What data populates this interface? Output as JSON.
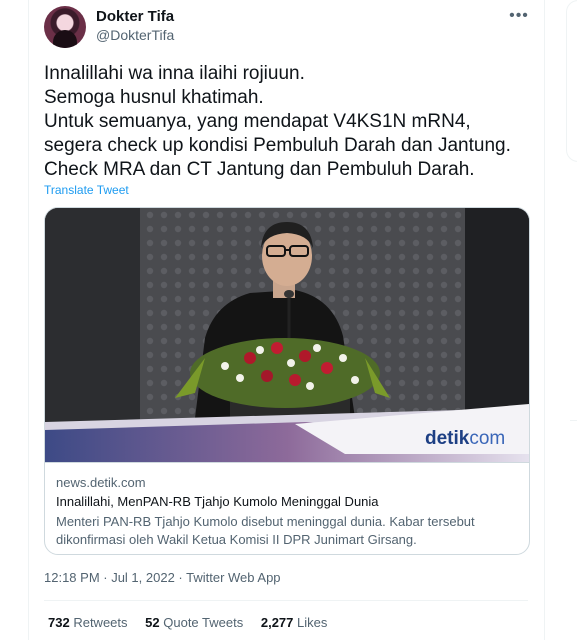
{
  "tweet": {
    "author": {
      "display_name": "Dokter Tifa",
      "handle": "@DokterTifa"
    },
    "text_lines": [
      "Innalillahi wa inna ilaihi rojiuun.",
      "Semoga husnul khatimah.",
      "Untuk semuanya, yang mendapat V4KS1N mRN4,",
      "segera check up kondisi Pembuluh Darah dan Jantung.",
      "Check MRA dan CT  Jantung dan Pembuluh Darah."
    ],
    "translate_label": "Translate Tweet",
    "more_icon": "more-horizontal-icon",
    "timestamp": "12:18 PM · Jul 1, 2022 · Twitter Web App"
  },
  "card": {
    "image_watermark": "detikcom",
    "domain": "news.detik.com",
    "title": "Innalillahi, MenPAN-RB Tjahjo Kumolo Meninggal Dunia",
    "description_lines": [
      "Menteri PAN-RB Tjahjo Kumolo disebut meninggal dunia. Kabar tersebut",
      "dikonfirmasi oleh Wakil Ketua Komisi II DPR Junimart Girsang."
    ]
  },
  "stats": {
    "retweets": {
      "count": "732",
      "label": "Retweets"
    },
    "quotes": {
      "count": "52",
      "label": "Quote Tweets"
    },
    "likes": {
      "count": "2,277",
      "label": "Likes"
    }
  },
  "colors": {
    "link": "#1d9bf0",
    "text": "#0f1419",
    "muted": "#536471",
    "border": "#cfd9de"
  }
}
